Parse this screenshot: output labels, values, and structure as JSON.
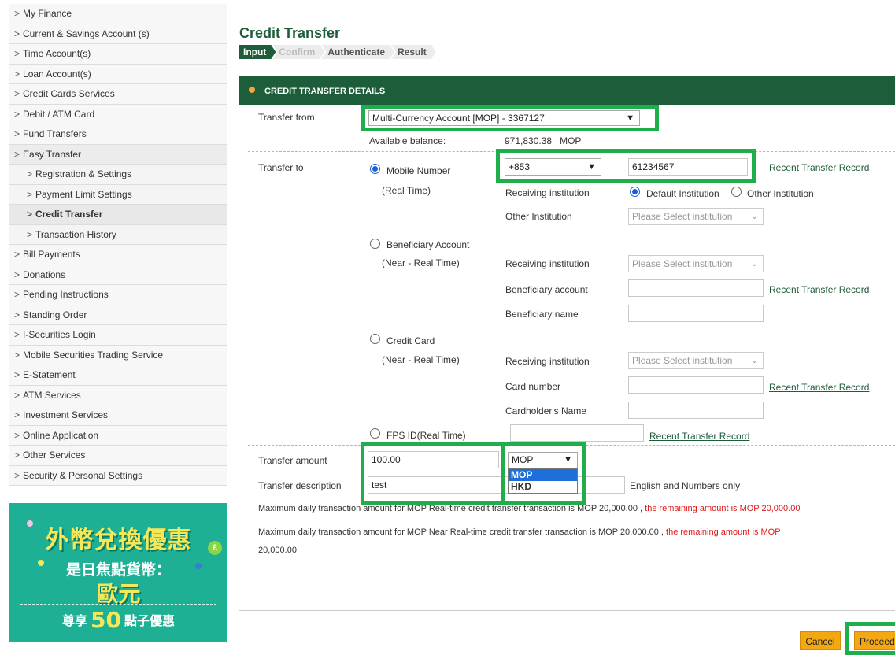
{
  "sidebar": {
    "items": [
      {
        "label": "My Finance"
      },
      {
        "label": "Current & Savings Account (s)"
      },
      {
        "label": "Time Account(s)"
      },
      {
        "label": "Loan Account(s)"
      },
      {
        "label": "Credit Cards Services"
      },
      {
        "label": "Debit / ATM Card"
      },
      {
        "label": "Fund Transfers"
      },
      {
        "label": "Easy Transfer"
      },
      {
        "label": "Registration & Settings"
      },
      {
        "label": "Payment Limit Settings"
      },
      {
        "label": "Credit Transfer"
      },
      {
        "label": "Transaction History"
      },
      {
        "label": "Bill Payments"
      },
      {
        "label": "Donations"
      },
      {
        "label": "Pending Instructions"
      },
      {
        "label": "Standing Order"
      },
      {
        "label": "I-Securities Login"
      },
      {
        "label": "Mobile Securities Trading Service"
      },
      {
        "label": "E-Statement"
      },
      {
        "label": "ATM Services"
      },
      {
        "label": "Investment Services"
      },
      {
        "label": "Online Application"
      },
      {
        "label": "Other Services"
      },
      {
        "label": "Security & Personal Settings"
      }
    ],
    "chevron": ">"
  },
  "banner": {
    "line1": "外幣兌換優惠",
    "line2": "是日焦點貨幣：",
    "line3": "歐元",
    "line4_pre": "尊享",
    "line4_num": "50",
    "line4_post": "點子優惠",
    "coin_symbol": "£"
  },
  "page": {
    "title": "Credit Transfer",
    "steps": [
      "Input",
      "Confirm",
      "Authenticate",
      "Result"
    ],
    "panel_title": "Credit Transfer Details"
  },
  "form": {
    "transfer_from_label": "Transfer from",
    "transfer_from_value": "Multi-Currency Account [MOP] - 3367127",
    "available_balance_label": "Available balance:",
    "available_balance_value": "971,830.38",
    "available_balance_currency": "MOP",
    "transfer_to_label": "Transfer to",
    "mobile_number_label": "Mobile Number",
    "real_time_label": "(Real Time)",
    "country_code": "+853",
    "mobile_value": "61234567",
    "recent_record": "Recent Transfer Record",
    "receiving_institution": "Receiving institution",
    "default_institution": "Default Institution",
    "other_institution": "Other Institution",
    "other_institution_label": "Other Institution",
    "select_institution_placeholder": "Please Select institution",
    "beneficiary_account_option": "Beneficiary Account",
    "near_real_time": "(Near - Real Time)",
    "beneficiary_account_label": "Beneficiary account",
    "beneficiary_name_label": "Beneficiary name",
    "credit_card_option": "Credit Card",
    "card_number_label": "Card number",
    "cardholder_name_label": "Cardholder's Name",
    "fps_option": "FPS ID(Real Time)",
    "transfer_amount_label": "Transfer amount",
    "transfer_amount_value": "100.00",
    "currency_value": "MOP",
    "currency_options": [
      "MOP",
      "HKD"
    ],
    "transfer_description_label": "Transfer description",
    "transfer_description_value": "test",
    "description_hint": "English and Numbers only",
    "note1_main": "Maximum daily transaction amount for MOP Real-time credit transfer transaction is MOP 20,000.00 ,",
    "note1_red": "the remaining amount is MOP 20,000.00",
    "note2_main": "Maximum daily transaction amount for MOP Near Real-time credit transfer transaction is MOP 20,000.00 ,",
    "note2_red_a": "the remaining amount is MOP",
    "note2_red_b": "20,000.00"
  },
  "buttons": {
    "cancel": "Cancel",
    "proceed": "Proceed"
  },
  "colors": {
    "brand_green": "#1d5d39",
    "highlight_green": "#1fae4b",
    "button_orange": "#f3a712",
    "warning_red": "#e01818"
  }
}
